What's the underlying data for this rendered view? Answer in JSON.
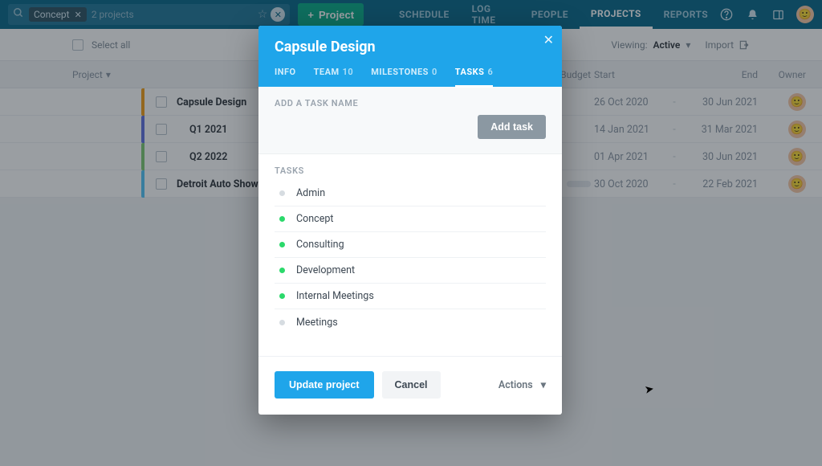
{
  "topbar": {
    "search_chip": "Concept",
    "search_placeholder": "2 projects",
    "new_project_label": "Project"
  },
  "nav": {
    "schedule": "SCHEDULE",
    "logtime": "LOG TIME",
    "people": "PEOPLE",
    "projects": "PROJECTS",
    "reports": "REPORTS"
  },
  "toolbar": {
    "select_all": "Select all",
    "viewing_label": "Viewing:",
    "viewing_value": "Active",
    "import": "Import"
  },
  "columns": {
    "project": "Project",
    "budget": "Budget",
    "start": "Start",
    "end": "End",
    "owner": "Owner"
  },
  "rows": [
    {
      "color": "#f39c12",
      "name": "Capsule Design",
      "indent": false,
      "start": "26 Oct 2020",
      "end": "30 Jun 2021",
      "budget_pill": false
    },
    {
      "color": "#5b6ee1",
      "name": "Q1 2021",
      "indent": true,
      "start": "14 Jan 2021",
      "end": "31 Mar 2021",
      "budget_pill": false
    },
    {
      "color": "#7bc96f",
      "name": "Q2 2022",
      "indent": true,
      "start": "01 Apr 2021",
      "end": "30 Jun 2021",
      "budget_pill": false
    },
    {
      "color": "#4fc3f7",
      "name": "Detroit Auto Show",
      "indent": false,
      "start": "30 Oct 2020",
      "end": "22 Feb 2021",
      "budget_pill": true
    }
  ],
  "modal": {
    "title": "Capsule Design",
    "tabs": {
      "info": "INFO",
      "team_label": "TEAM",
      "team_count": "10",
      "milestones_label": "MILESTONES",
      "milestones_count": "0",
      "tasks_label": "TASKS",
      "tasks_count": "6"
    },
    "add_task_label": "ADD A TASK NAME",
    "add_task_button": "Add task",
    "tasks_heading": "TASKS",
    "tasks": [
      {
        "name": "Admin",
        "active": false
      },
      {
        "name": "Concept",
        "active": true
      },
      {
        "name": "Consulting",
        "active": true
      },
      {
        "name": "Development",
        "active": true
      },
      {
        "name": "Internal Meetings",
        "active": true
      },
      {
        "name": "Meetings",
        "active": false
      }
    ],
    "update": "Update project",
    "cancel": "Cancel",
    "actions": "Actions"
  }
}
